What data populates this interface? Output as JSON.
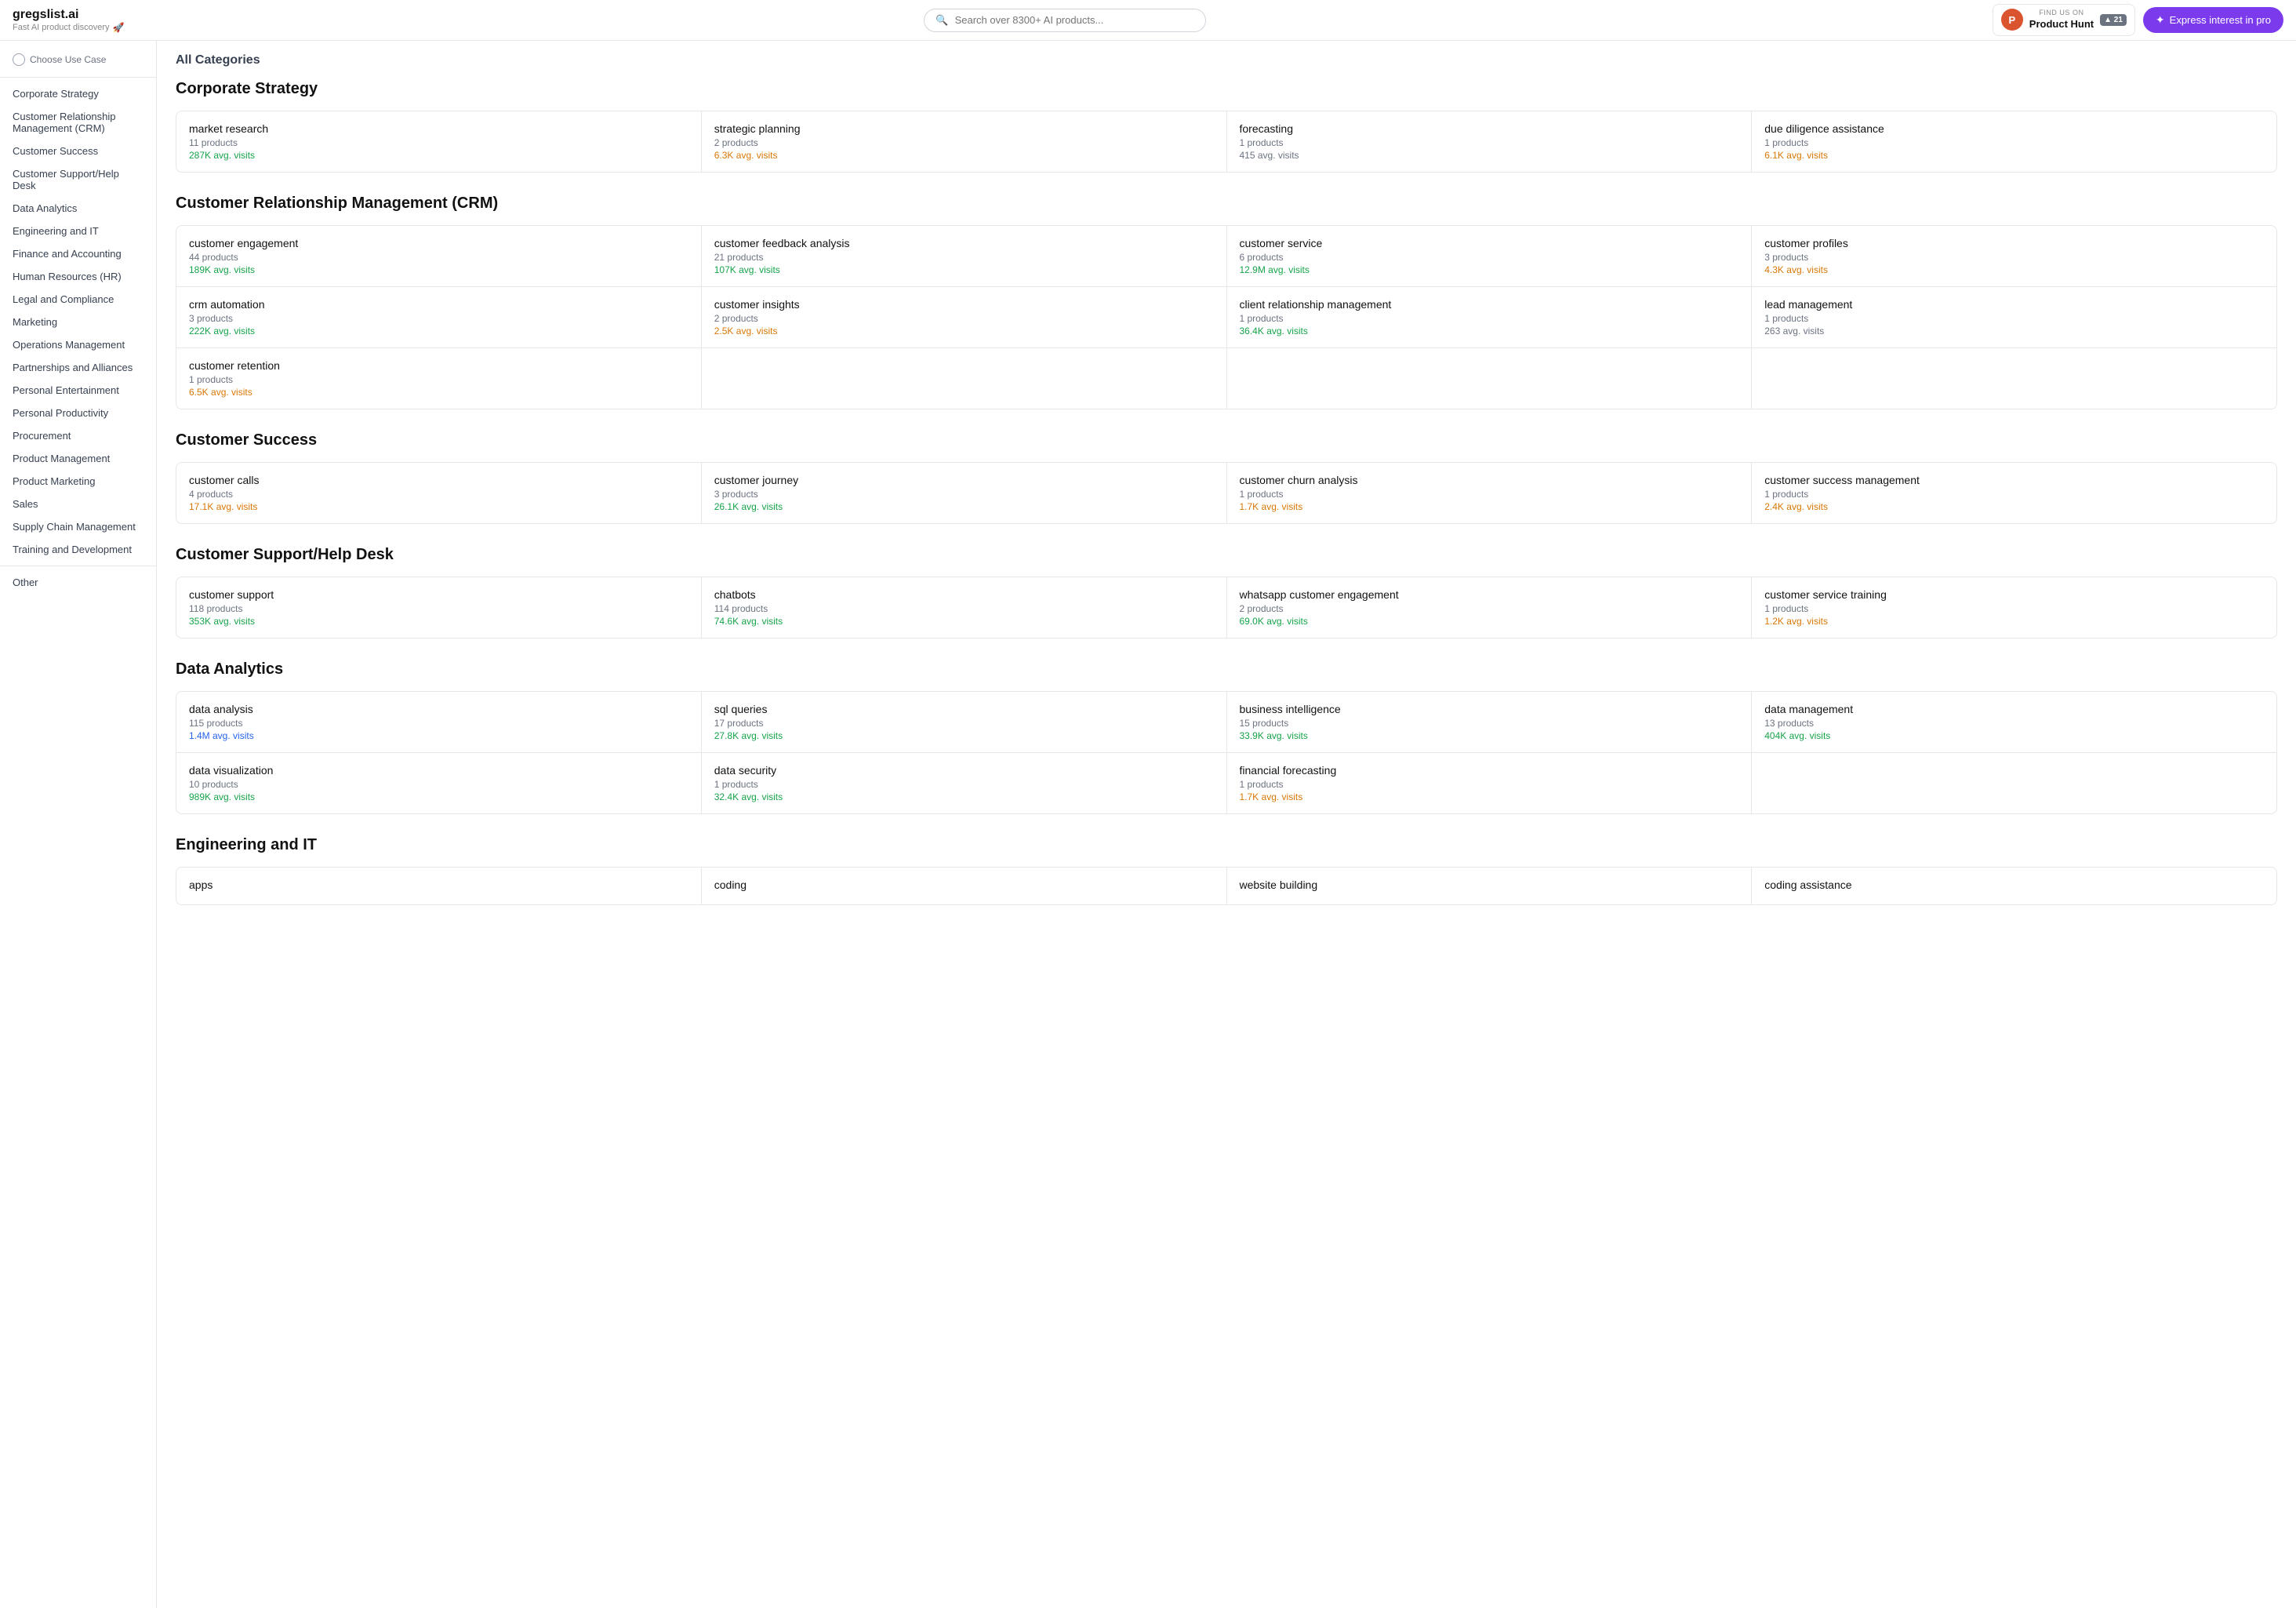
{
  "header": {
    "logo_title": "gregslist.ai",
    "logo_subtitle": "Fast AI product discovery",
    "search_placeholder": "Search over 8300+ AI products...",
    "product_hunt_find_us": "FIND US ON",
    "product_hunt_name": "Product Hunt",
    "product_hunt_count": "▲ 21",
    "express_btn": "Express interest in pro"
  },
  "sidebar": {
    "choose_use_case": "Choose Use Case",
    "items": [
      "Corporate Strategy",
      "Customer Relationship Management (CRM)",
      "Customer Success",
      "Customer Support/Help Desk",
      "Data Analytics",
      "Engineering and IT",
      "Finance and Accounting",
      "Human Resources (HR)",
      "Legal and Compliance",
      "Marketing",
      "Operations Management",
      "Partnerships and Alliances",
      "Personal Entertainment",
      "Personal Productivity",
      "Procurement",
      "Product Management",
      "Product Marketing",
      "Sales",
      "Supply Chain Management",
      "Training and Development"
    ],
    "other": "Other"
  },
  "page_title": "All Categories",
  "categories": [
    {
      "name": "Corporate Strategy",
      "cards": [
        {
          "name": "market research",
          "products": "11 products",
          "visits": "287K avg. visits",
          "color": "green"
        },
        {
          "name": "strategic planning",
          "products": "2 products",
          "visits": "6.3K avg. visits",
          "color": "orange"
        },
        {
          "name": "forecasting",
          "products": "1 products",
          "visits": "415 avg. visits",
          "color": "gray"
        },
        {
          "name": "due diligence assistance",
          "products": "1 products",
          "visits": "6.1K avg. visits",
          "color": "orange"
        }
      ]
    },
    {
      "name": "Customer Relationship Management (CRM)",
      "cards": [
        {
          "name": "customer engagement",
          "products": "44 products",
          "visits": "189K avg. visits",
          "color": "green"
        },
        {
          "name": "customer feedback analysis",
          "products": "21 products",
          "visits": "107K avg. visits",
          "color": "green"
        },
        {
          "name": "customer service",
          "products": "6 products",
          "visits": "12.9M avg. visits",
          "color": "green"
        },
        {
          "name": "customer profiles",
          "products": "3 products",
          "visits": "4.3K avg. visits",
          "color": "orange"
        },
        {
          "name": "crm automation",
          "products": "3 products",
          "visits": "222K avg. visits",
          "color": "green"
        },
        {
          "name": "customer insights",
          "products": "2 products",
          "visits": "2.5K avg. visits",
          "color": "orange"
        },
        {
          "name": "client relationship management",
          "products": "1 products",
          "visits": "36.4K avg. visits",
          "color": "green"
        },
        {
          "name": "lead management",
          "products": "1 products",
          "visits": "263 avg. visits",
          "color": "gray"
        },
        {
          "name": "customer retention",
          "products": "1 products",
          "visits": "6.5K avg. visits",
          "color": "orange"
        }
      ]
    },
    {
      "name": "Customer Success",
      "cards": [
        {
          "name": "customer calls",
          "products": "4 products",
          "visits": "17.1K avg. visits",
          "color": "orange"
        },
        {
          "name": "customer journey",
          "products": "3 products",
          "visits": "26.1K avg. visits",
          "color": "green"
        },
        {
          "name": "customer churn analysis",
          "products": "1 products",
          "visits": "1.7K avg. visits",
          "color": "orange"
        },
        {
          "name": "customer success management",
          "products": "1 products",
          "visits": "2.4K avg. visits",
          "color": "orange"
        }
      ]
    },
    {
      "name": "Customer Support/Help Desk",
      "cards": [
        {
          "name": "customer support",
          "products": "118 products",
          "visits": "353K avg. visits",
          "color": "green"
        },
        {
          "name": "chatbots",
          "products": "114 products",
          "visits": "74.6K avg. visits",
          "color": "green"
        },
        {
          "name": "whatsapp customer engagement",
          "products": "2 products",
          "visits": "69.0K avg. visits",
          "color": "green"
        },
        {
          "name": "customer service training",
          "products": "1 products",
          "visits": "1.2K avg. visits",
          "color": "orange"
        }
      ]
    },
    {
      "name": "Data Analytics",
      "cards": [
        {
          "name": "data analysis",
          "products": "115 products",
          "visits": "1.4M avg. visits",
          "color": "blue"
        },
        {
          "name": "sql queries",
          "products": "17 products",
          "visits": "27.8K avg. visits",
          "color": "green"
        },
        {
          "name": "business intelligence",
          "products": "15 products",
          "visits": "33.9K avg. visits",
          "color": "green"
        },
        {
          "name": "data management",
          "products": "13 products",
          "visits": "404K avg. visits",
          "color": "green"
        },
        {
          "name": "data visualization",
          "products": "10 products",
          "visits": "989K avg. visits",
          "color": "green"
        },
        {
          "name": "data security",
          "products": "1 products",
          "visits": "32.4K avg. visits",
          "color": "green"
        },
        {
          "name": "financial forecasting",
          "products": "1 products",
          "visits": "1.7K avg. visits",
          "color": "orange"
        }
      ]
    },
    {
      "name": "Engineering and IT",
      "cards": [
        {
          "name": "apps",
          "products": "",
          "visits": "",
          "color": "gray"
        },
        {
          "name": "coding",
          "products": "",
          "visits": "",
          "color": "gray"
        },
        {
          "name": "website building",
          "products": "",
          "visits": "",
          "color": "gray"
        },
        {
          "name": "coding assistance",
          "products": "",
          "visits": "",
          "color": "gray"
        }
      ]
    }
  ]
}
